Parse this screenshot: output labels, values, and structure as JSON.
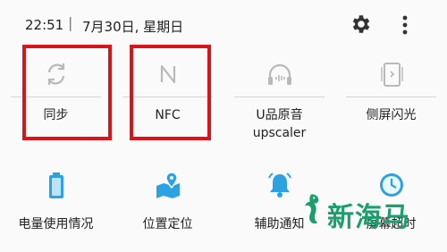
{
  "status": {
    "time": "22:51",
    "separator": "|",
    "date": "7月30日, 星期日"
  },
  "icons": {
    "settings": "gear-icon",
    "more": "more-vert-icon"
  },
  "tiles_row1": [
    {
      "label": "同步",
      "icon": "sync-icon",
      "active": false,
      "highlighted": true
    },
    {
      "label": "NFC",
      "icon": "nfc-icon",
      "active": false,
      "highlighted": true
    },
    {
      "label": "U品原音 upscaler",
      "label_line1": "U品原音",
      "label_line2": "upscaler",
      "icon": "headphones-icon",
      "active": false,
      "highlighted": false
    },
    {
      "label": "侧屏闪光",
      "icon": "edge-lighting-icon",
      "active": false,
      "highlighted": false
    }
  ],
  "tiles_row2": [
    {
      "label": "电量使用情况",
      "icon": "battery-icon",
      "active": true
    },
    {
      "label": "位置定位",
      "icon": "location-icon",
      "active": true
    },
    {
      "label": "辅助通知",
      "icon": "bell-icon",
      "active": true
    },
    {
      "label": "屏幕超时",
      "icon": "clock-icon",
      "active": true
    }
  ],
  "colors": {
    "accent": "#2ca3e0",
    "inactive_icon": "#b9b9b9",
    "highlight": "#d8151b",
    "watermark": "#1c9e6e"
  },
  "watermark": {
    "text": "新海马"
  }
}
